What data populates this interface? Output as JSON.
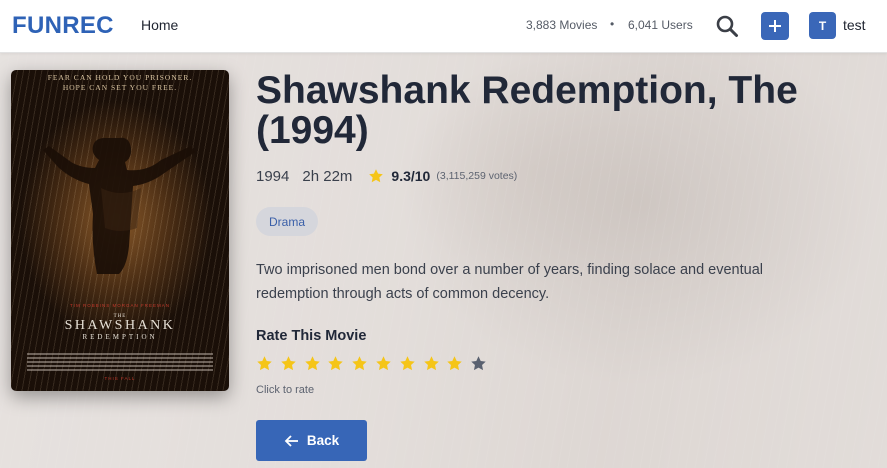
{
  "header": {
    "logo": "FUNREC",
    "nav_home": "Home",
    "movies_count": "3,883 Movies",
    "separator": "•",
    "users_count": "6,041 Users",
    "search_icon": "search-icon",
    "add_icon": "plus-icon",
    "avatar_initial": "T",
    "username": "test"
  },
  "poster": {
    "tagline_line1": "FEAR CAN HOLD YOU PRISONER.",
    "tagline_line2": "HOPE CAN SET YOU FREE.",
    "cast": "TIM ROBBINS     MORGAN FREEMAN",
    "title_small": "THE",
    "title_big": "SHAWSHANK",
    "title_sub": "REDEMPTION",
    "release": "THIS FALL"
  },
  "movie": {
    "title": "Shawshank Redemption, The (1994)",
    "year": "1994",
    "runtime": "2h 22m",
    "rating": "9.3/10",
    "votes": "(3,115,259 votes)",
    "genre": "Drama",
    "overview": "Two imprisoned men bond over a number of years, finding solace and eventual redemption through acts of common decency."
  },
  "rate": {
    "heading": "Rate This Movie",
    "stars_total": 10,
    "stars_filled": 9,
    "hint": "Click to rate"
  },
  "back_button": {
    "label": "Back",
    "icon": "arrow-left-icon"
  },
  "colors": {
    "brand": "#2e62b6",
    "accent": "#3766b7",
    "star_filled": "#f5c518",
    "star_empty": "#5a6170"
  }
}
